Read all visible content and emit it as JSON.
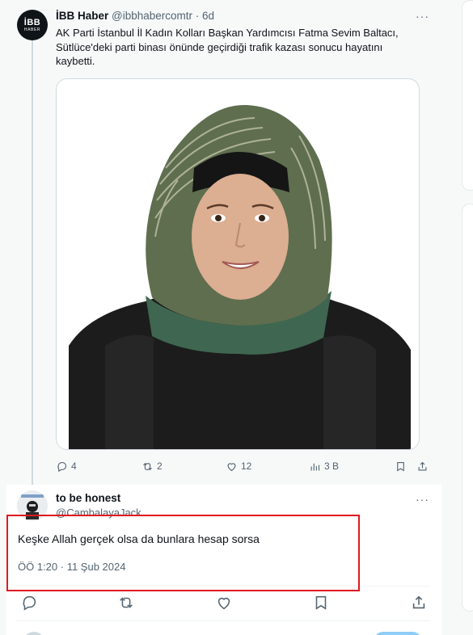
{
  "tweet1": {
    "avatar": {
      "line1": "İBB",
      "line2": "HABER"
    },
    "name": "İBB Haber",
    "handle": "@ibbhabercomtr",
    "time": "· 6d",
    "more": "···",
    "text": "AK Parti İstanbul İl Kadın Kolları Başkan Yardımcısı Fatma Sevim Baltacı, Sütlüce'deki parti binası önünde geçirdiği trafik kazası sonucu hayatını kaybetti.",
    "stats": {
      "replies": "4",
      "reposts": "2",
      "likes": "12",
      "views": "3 B"
    }
  },
  "tweet2": {
    "name": "to be honest",
    "handle": "@CambalayaJack",
    "more": "···",
    "text": "Keşke Allah gerçek olsa da bunlara hesap sorsa",
    "timestamp": "ÖÖ 1:20 · 11 Şub 2024"
  },
  "colors": {
    "accent": "#1d9bf0",
    "highlight": "#e0191e",
    "muted": "#536471"
  }
}
